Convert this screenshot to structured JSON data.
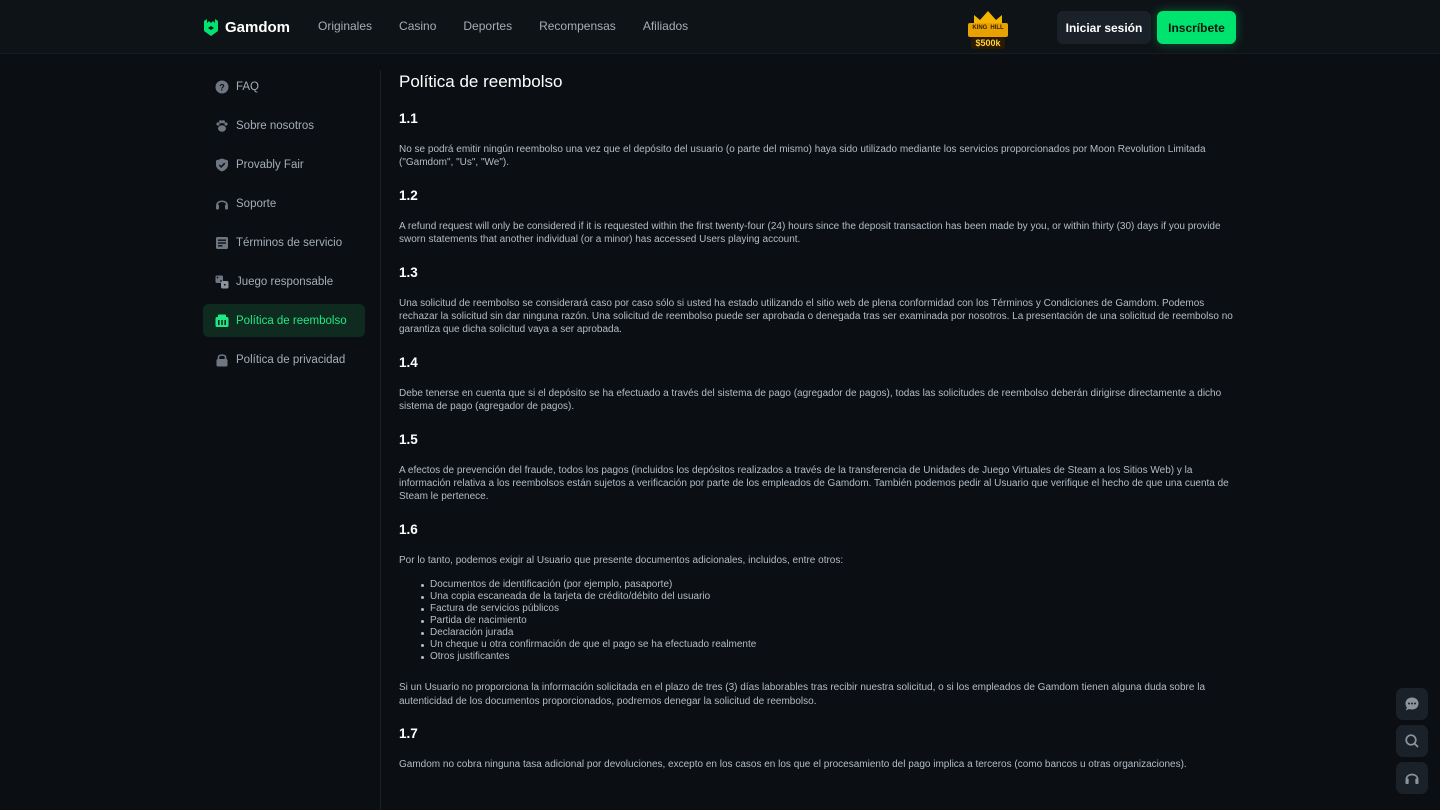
{
  "header": {
    "logo_text": "Gamdom",
    "nav": [
      "Originales",
      "Casino",
      "Deportes",
      "Recompensas",
      "Afiliados"
    ],
    "promo": {
      "line1": "KING",
      "line2": "HILL",
      "amount": "$500k"
    },
    "login_label": "Iniciar sesión",
    "signup_label": "Inscríbete"
  },
  "sidebar": {
    "items": [
      {
        "label": "FAQ",
        "icon": "question-icon"
      },
      {
        "label": "Sobre nosotros",
        "icon": "paw-icon"
      },
      {
        "label": "Provably Fair",
        "icon": "shield-check-icon"
      },
      {
        "label": "Soporte",
        "icon": "headset-icon"
      },
      {
        "label": "Términos de servicio",
        "icon": "document-icon"
      },
      {
        "label": "Juego responsable",
        "icon": "dice-icon"
      },
      {
        "label": "Política de reembolso",
        "icon": "refund-icon",
        "active": true
      },
      {
        "label": "Política de privacidad",
        "icon": "lock-icon"
      }
    ]
  },
  "content": {
    "title": "Política de reembolso",
    "sections": [
      {
        "num": "1.1",
        "text": "No se podrá emitir ningún reembolso una vez que el depósito del usuario (o parte del mismo) haya sido utilizado mediante los servicios proporcionados por Moon Revolution Limitada (\"Gamdom\", \"Us\", \"We\")."
      },
      {
        "num": "1.2",
        "text": "A refund request will only be considered if it is requested within the first twenty-four (24) hours since the deposit transaction has been made by you, or within thirty (30) days if you provide sworn statements that another individual (or a minor) has accessed Users playing account."
      },
      {
        "num": "1.3",
        "text": "Una solicitud de reembolso se considerará caso por caso sólo si usted ha estado utilizando el sitio web de plena conformidad con los Términos y Condiciones de Gamdom. Podemos rechazar la solicitud sin dar ninguna razón. Una solicitud de reembolso puede ser aprobada o denegada tras ser examinada por nosotros. La presentación de una solicitud de reembolso no garantiza que dicha solicitud vaya a ser aprobada."
      },
      {
        "num": "1.4",
        "text": "Debe tenerse en cuenta que si el depósito se ha efectuado a través del sistema de pago (agregador de pagos), todas las solicitudes de reembolso deberán dirigirse directamente a dicho sistema de pago (agregador de pagos)."
      },
      {
        "num": "1.5",
        "text": "A efectos de prevención del fraude, todos los pagos (incluidos los depósitos realizados a través de la transferencia de Unidades de Juego Virtuales de Steam a los Sitios Web) y la información relativa a los reembolsos están sujetos a verificación por parte de los empleados de Gamdom. También podemos pedir al Usuario que verifique el hecho de que una cuenta de Steam le pertenece."
      },
      {
        "num": "1.6",
        "text": "Por lo tanto, podemos exigir al Usuario que presente documentos adicionales, incluidos, entre otros:",
        "list": [
          "Documentos de identificación (por ejemplo, pasaporte)",
          "Una copia escaneada de la tarjeta de crédito/débito del usuario",
          "Factura de servicios públicos",
          "Partida de nacimiento",
          "Declaración jurada",
          "Un cheque u otra confirmación de que el pago se ha efectuado realmente",
          "Otros justificantes"
        ],
        "after": "Si un Usuario no proporciona la información solicitada en el plazo de tres (3) días laborables tras recibir nuestra solicitud, o si los empleados de Gamdom tienen alguna duda sobre la autenticidad de los documentos proporcionados, podremos denegar la solicitud de reembolso."
      },
      {
        "num": "1.7",
        "text": "Gamdom no cobra ninguna tasa adicional por devoluciones, excepto en los casos en los que el procesamiento del pago implica a terceros (como bancos u otras organizaciones)."
      }
    ]
  },
  "floating": [
    "chat-icon",
    "search-icon",
    "headset-icon"
  ],
  "colors": {
    "accent": "#00e36f",
    "active_text": "#1fe987",
    "bg": "#0b0f13"
  }
}
